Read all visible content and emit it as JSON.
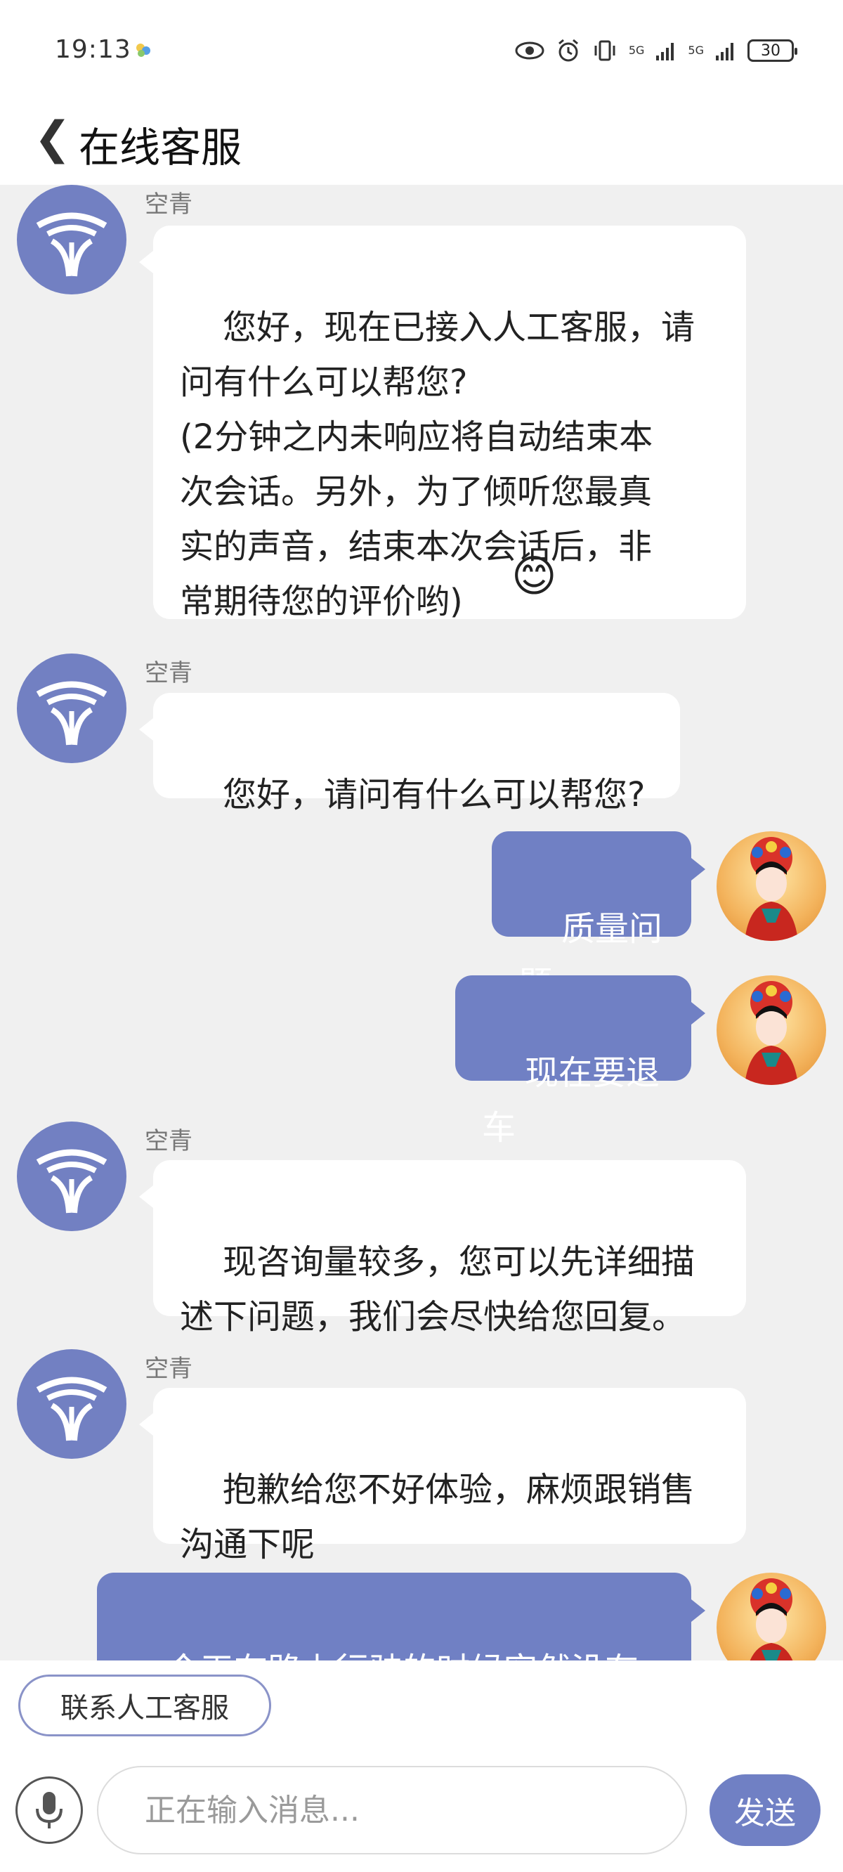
{
  "status_bar": {
    "time": "19:13",
    "net1": "5G",
    "net2": "5G",
    "battery": "30",
    "icons": [
      "app-dot-icon",
      "eye-icon",
      "alarm-icon",
      "vibrate-icon",
      "signal-icon",
      "signal-icon",
      "battery-icon"
    ]
  },
  "header": {
    "back_glyph": "❮",
    "title": "在线客服"
  },
  "messages": [
    {
      "side": "left",
      "sender": "空青",
      "text": "您好，现在已接入人工客服，请\n问有什么可以帮您?\n(2分钟之内未响应将自动结束本\n次会话。另外，为了倾听您最真\n实的声音，结束本次会话后，非\n常期待您的评价哟)",
      "emoji": "😊"
    },
    {
      "side": "left",
      "sender": "空青",
      "text": "您好，请问有什么可以帮您?"
    },
    {
      "side": "right",
      "text": "质量问题"
    },
    {
      "side": "right",
      "text": "现在要退车"
    },
    {
      "side": "left",
      "sender": "空青",
      "text": "现咨询量较多，您可以先详细描\n述下问题，我们会尽快给您回复。"
    },
    {
      "side": "left",
      "sender": "空青",
      "text": "抱歉给您不好体验，麻烦跟销售\n沟通下呢"
    },
    {
      "side": "right",
      "text": "今天在路上行驶的时候突然没有"
    }
  ],
  "bottom": {
    "contact_label": "联系人工客服",
    "input_placeholder": "正在输入消息...",
    "send_label": "发送"
  },
  "colors": {
    "accent": "#7080c4",
    "chat_bg": "#f0f0f0"
  }
}
